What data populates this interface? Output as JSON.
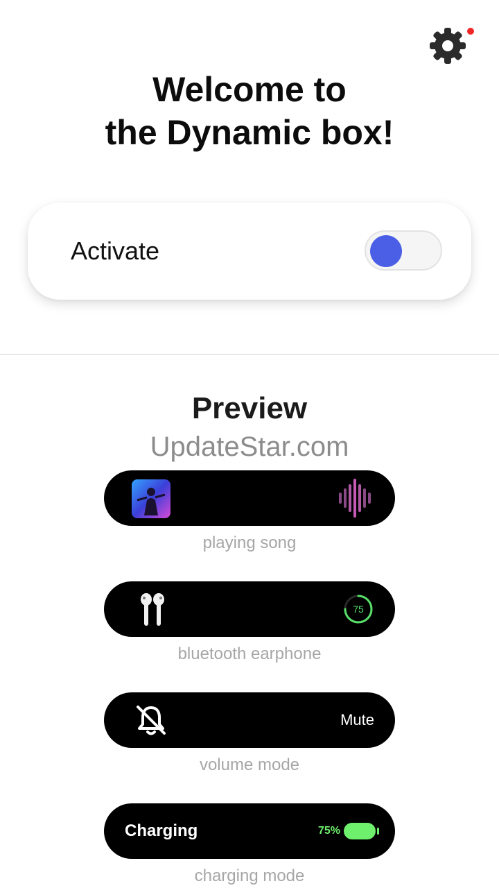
{
  "header": {
    "title_line1": "Welcome to",
    "title_line2": "the Dynamic box!",
    "settings_icon": "gear-icon",
    "notification_color": "#f02727"
  },
  "activate": {
    "label": "Activate",
    "toggle_on": true,
    "accent_color": "#4a5fe6"
  },
  "preview": {
    "title": "Preview",
    "watermark": "UpdateStar.com",
    "items": [
      {
        "caption": "playing song",
        "icons": [
          "album-art-icon",
          "waveform-icon"
        ]
      },
      {
        "caption": "bluetooth earphone",
        "icons": [
          "earbuds-icon"
        ],
        "battery_ring_value": "75"
      },
      {
        "caption": "volume mode",
        "icons": [
          "bell-off-icon"
        ],
        "status": "Mute"
      },
      {
        "caption": "charging mode",
        "label": "Charging",
        "battery_percent": "75%",
        "icons": [
          "battery-icon"
        ]
      }
    ]
  }
}
